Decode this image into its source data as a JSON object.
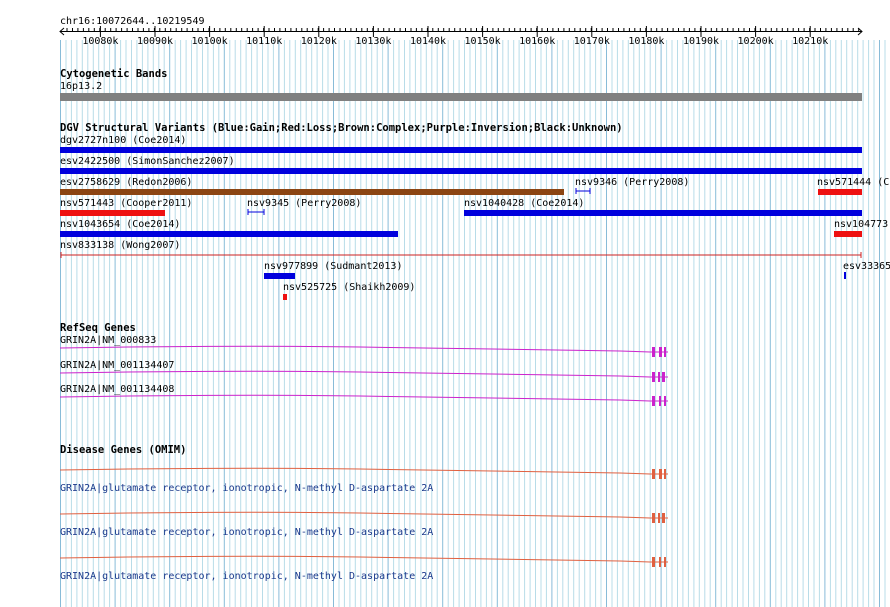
{
  "locus": "chr16:10072644..10219549",
  "ruler": {
    "ticks": [
      "10080k",
      "10090k",
      "10100k",
      "10110k",
      "10120k",
      "10130k",
      "10140k",
      "10150k",
      "10160k",
      "10170k",
      "10180k",
      "10190k",
      "10200k",
      "10210k"
    ]
  },
  "cytoband": {
    "title": "Cytogenetic Bands",
    "band_label": "16p13.2"
  },
  "dgv": {
    "title": "DGV Structural Variants (Blue:Gain;Red:Loss;Brown:Complex;Purple:Inversion;Black:Unknown)",
    "colors": {
      "gain": "#0000dd",
      "loss": "#ee1111",
      "complex": "#8b4513",
      "thin": "#cc2222"
    },
    "labels": {
      "dgv2727n100": "dgv2727n100 (Coe2014)",
      "esv2422500": "esv2422500 (SimonSanchez2007)",
      "esv2758629": "esv2758629 (Redon2006)",
      "nsv9346": "nsv9346 (Perry2008)",
      "nsv571444": "nsv571444 (C",
      "nsv571443": "nsv571443 (Cooper2011)",
      "nsv9345": "nsv9345 (Perry2008)",
      "nsv1040428": "nsv1040428 (Coe2014)",
      "nsv1043654": "nsv1043654 (Coe2014)",
      "nsv104773": "nsv104773",
      "nsv833138": "nsv833138 (Wong2007)",
      "nsv977899": "nsv977899 (Sudmant2013)",
      "esv33365": "esv33365",
      "nsv525725": "nsv525725 (Shaikh2009)"
    }
  },
  "refseq": {
    "title": "RefSeq Genes",
    "color": "#cc22cc",
    "transcripts": [
      "GRIN2A|NM_000833",
      "GRIN2A|NM_001134407",
      "GRIN2A|NM_001134408"
    ]
  },
  "omim": {
    "title": "Disease Genes (OMIM)",
    "color": "#e06040",
    "label_color": "#1b3a8c",
    "entries": [
      "GRIN2A|glutamate receptor, ionotropic, N-methyl D-aspartate 2A",
      "GRIN2A|glutamate receptor, ionotropic, N-methyl D-aspartate 2A",
      "GRIN2A|glutamate receptor, ionotropic, N-methyl D-aspartate 2A"
    ]
  }
}
